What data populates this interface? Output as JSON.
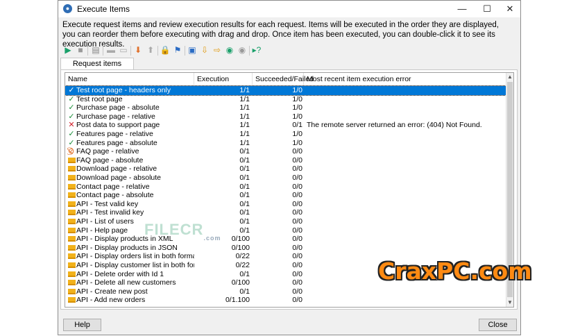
{
  "window": {
    "title": "Execute Items",
    "icon": "app-icon",
    "controls": {
      "minimize": "—",
      "maximize": "☐",
      "close": "✕"
    }
  },
  "description": "Execute request items and review execution results for each request. Items will be executed in the order they are displayed, you can reorder them before executing with drag and drop. Once item has been executed, you can double-click it to see its execution results.",
  "toolbar": {
    "icons": [
      "play-icon",
      "stop-icon",
      "list-icon",
      "collapse-icon",
      "expand-icon",
      "move-down-icon",
      "move-up-icon",
      "lock-icon",
      "filter-icon",
      "edit-icon",
      "import-icon",
      "export-icon",
      "enable-icon",
      "disable-icon",
      "run-selected-icon"
    ]
  },
  "tabs": [
    {
      "label": "Request items",
      "active": true
    }
  ],
  "table": {
    "columns": [
      "Name",
      "Execution progress",
      "Succeeded/Failed",
      "Most recent item execution error"
    ],
    "rows": [
      {
        "status": "check",
        "name": "Test root page - headers only",
        "progress": "1/1",
        "result": "1/0",
        "error": "",
        "selected": true
      },
      {
        "status": "check",
        "name": "Test root page",
        "progress": "1/1",
        "result": "1/0",
        "error": ""
      },
      {
        "status": "check",
        "name": "Purchase page - absolute",
        "progress": "1/1",
        "result": "1/0",
        "error": ""
      },
      {
        "status": "check",
        "name": "Purchase page - relative",
        "progress": "1/1",
        "result": "1/0",
        "error": ""
      },
      {
        "status": "x",
        "name": "Post data to support page",
        "progress": "1/1",
        "result": "0/1",
        "error": "The remote server returned an error: (404) Not Found."
      },
      {
        "status": "check",
        "name": "Features page - relative",
        "progress": "1/1",
        "result": "1/0",
        "error": ""
      },
      {
        "status": "check",
        "name": "Features page - absolute",
        "progress": "1/1",
        "result": "1/0",
        "error": ""
      },
      {
        "status": "stop",
        "name": "FAQ page - relative",
        "progress": "0/1",
        "result": "0/0",
        "error": ""
      },
      {
        "status": "queue",
        "name": "FAQ page - absolute",
        "progress": "0/1",
        "result": "0/0",
        "error": ""
      },
      {
        "status": "queue",
        "name": "Download page - relative",
        "progress": "0/1",
        "result": "0/0",
        "error": ""
      },
      {
        "status": "queue",
        "name": "Download page - absolute",
        "progress": "0/1",
        "result": "0/0",
        "error": ""
      },
      {
        "status": "queue",
        "name": "Contact page - relative",
        "progress": "0/1",
        "result": "0/0",
        "error": ""
      },
      {
        "status": "queue",
        "name": "Contact page - absolute",
        "progress": "0/1",
        "result": "0/0",
        "error": ""
      },
      {
        "status": "queue",
        "name": "API - Test valid key",
        "progress": "0/1",
        "result": "0/0",
        "error": ""
      },
      {
        "status": "queue",
        "name": "API - Test invalid key",
        "progress": "0/1",
        "result": "0/0",
        "error": ""
      },
      {
        "status": "queue",
        "name": "API - List of users",
        "progress": "0/1",
        "result": "0/0",
        "error": ""
      },
      {
        "status": "queue",
        "name": "API - Help page",
        "progress": "0/1",
        "result": "0/0",
        "error": ""
      },
      {
        "status": "queue",
        "name": "API - Display products in XML",
        "progress": "0/100",
        "result": "0/0",
        "error": ""
      },
      {
        "status": "queue",
        "name": "API - Display products in JSON",
        "progress": "0/100",
        "result": "0/0",
        "error": ""
      },
      {
        "status": "queue",
        "name": "API - Display orders list in both formats",
        "progress": "0/22",
        "result": "0/0",
        "error": ""
      },
      {
        "status": "queue",
        "name": "API - Display customer list in both formats",
        "progress": "0/22",
        "result": "0/0",
        "error": ""
      },
      {
        "status": "queue",
        "name": "API - Delete order with Id 1",
        "progress": "0/1",
        "result": "0/0",
        "error": ""
      },
      {
        "status": "queue",
        "name": "API - Delete all new customers",
        "progress": "0/100",
        "result": "0/0",
        "error": ""
      },
      {
        "status": "queue",
        "name": "API - Create new post",
        "progress": "0/1",
        "result": "0/0",
        "error": ""
      },
      {
        "status": "queue",
        "name": "API - Add new orders",
        "progress": "0/1.100",
        "result": "0/0",
        "error": ""
      }
    ]
  },
  "buttons": {
    "help": "Help",
    "close": "Close"
  },
  "watermarks": {
    "filecr": "FILECR",
    "filecr_suffix": ".com",
    "craxpc": "CraxPC.com"
  },
  "colors": {
    "selection": "#0078d7",
    "success": "#1a8f3a",
    "failure": "#d0202a",
    "queued": "#f2b21b"
  }
}
